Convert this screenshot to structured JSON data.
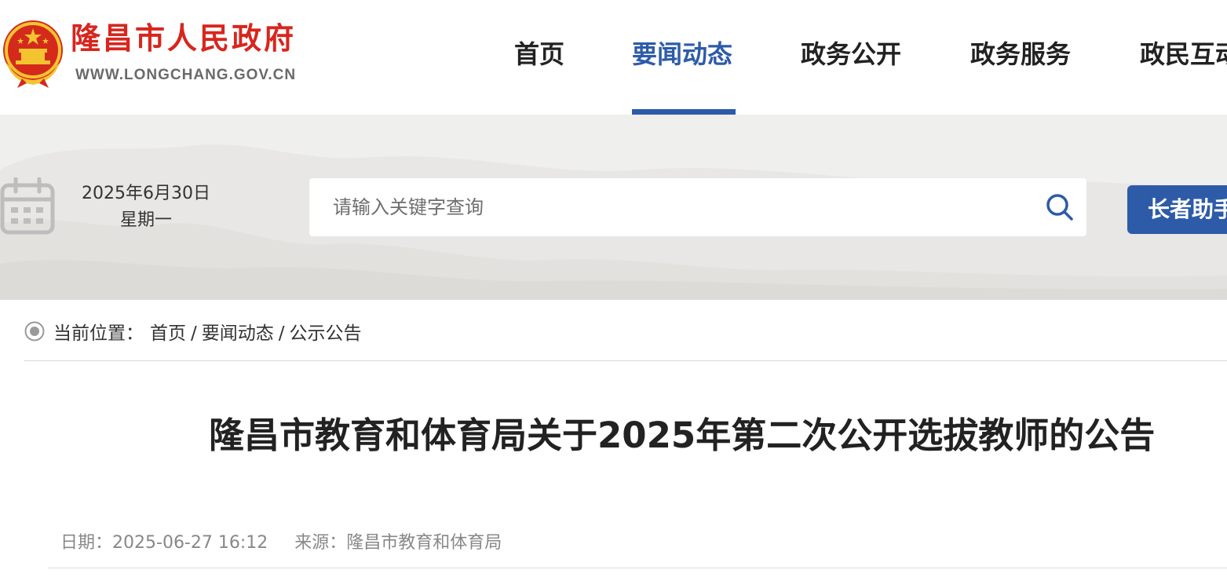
{
  "header": {
    "site_name": "隆昌市人民政府",
    "site_url": "WWW.LONGCHANG.GOV.CN",
    "emblem_icon": "national-emblem-icon",
    "nav": [
      {
        "label": "首页",
        "active": false
      },
      {
        "label": "要闻动态",
        "active": true
      },
      {
        "label": "政务公开",
        "active": false
      },
      {
        "label": "政务服务",
        "active": false
      },
      {
        "label": "政民互动",
        "active": false
      }
    ]
  },
  "banner": {
    "calendar_icon": "calendar-icon",
    "date": "2025年6月30日",
    "weekday": "星期一",
    "search": {
      "placeholder": "请输入关键字查询",
      "value": "",
      "icon": "search-icon"
    },
    "elder_button": "长者助手"
  },
  "breadcrumb": {
    "icon": "location-dot-icon",
    "prefix": "当前位置：",
    "items": [
      "首页",
      "要闻动态",
      "公示公告"
    ],
    "separator": "/"
  },
  "article": {
    "title": "隆昌市教育和体育局关于2025年第二次公开选拔教师的公告",
    "date_label": "日期：",
    "date_value": "2025-06-27 16:12",
    "source_label": "来源：",
    "source_value": "隆昌市教育和体育局"
  },
  "colors": {
    "brand_red": "#d7261e",
    "accent_blue": "#2d5ba8",
    "banner_bg": "#efefee"
  }
}
